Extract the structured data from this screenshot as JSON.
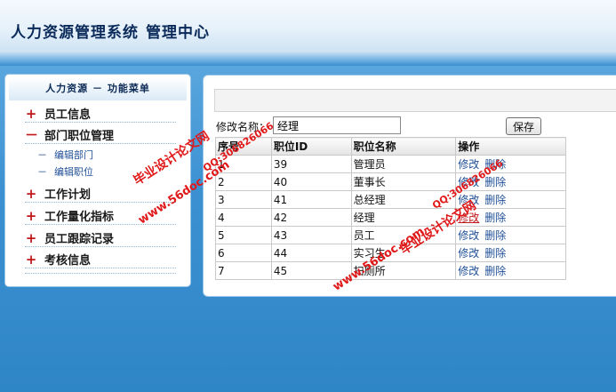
{
  "header": {
    "title": "人力资源管理系统",
    "subtitle": "管理中心"
  },
  "sidebar": {
    "heading": "人力资源 － 功能菜单",
    "items": [
      {
        "mark": "+",
        "label": "员工信息"
      },
      {
        "mark": "－",
        "label": "部门职位管理"
      },
      {
        "mark": "+",
        "label": "工作计划"
      },
      {
        "mark": "+",
        "label": "工作量化指标"
      },
      {
        "mark": "+",
        "label": "员工跟踪记录"
      },
      {
        "mark": "+",
        "label": "考核信息"
      }
    ],
    "subitems": [
      {
        "dash": "－",
        "label": "编辑部门"
      },
      {
        "dash": "－",
        "label": "编辑职位"
      }
    ]
  },
  "form": {
    "label": "修改名称：",
    "value": "经理",
    "save_label": "保存"
  },
  "table": {
    "columns": [
      "序号",
      "职位ID",
      "职位名称",
      "操作"
    ],
    "rows": [
      {
        "no": "1",
        "id": "39",
        "name": "管理员"
      },
      {
        "no": "2",
        "id": "40",
        "name": "董事长"
      },
      {
        "no": "3",
        "id": "41",
        "name": "总经理"
      },
      {
        "no": "4",
        "id": "42",
        "name": "经理"
      },
      {
        "no": "5",
        "id": "43",
        "name": "员工"
      },
      {
        "no": "6",
        "id": "44",
        "name": "实习生"
      },
      {
        "no": "7",
        "id": "45",
        "name": "扫厕所"
      }
    ],
    "edit_label": "修改",
    "delete_label": "删除"
  },
  "watermarks": {
    "site": "www.56doc.com",
    "qq": "QQ:306826066",
    "brand": "毕业设计论文网"
  },
  "colors": {
    "accent_red": "#c0181b",
    "link_blue": "#1f4f97",
    "page_blue": "#2f86c6",
    "watermark_red": "#e0191a"
  }
}
